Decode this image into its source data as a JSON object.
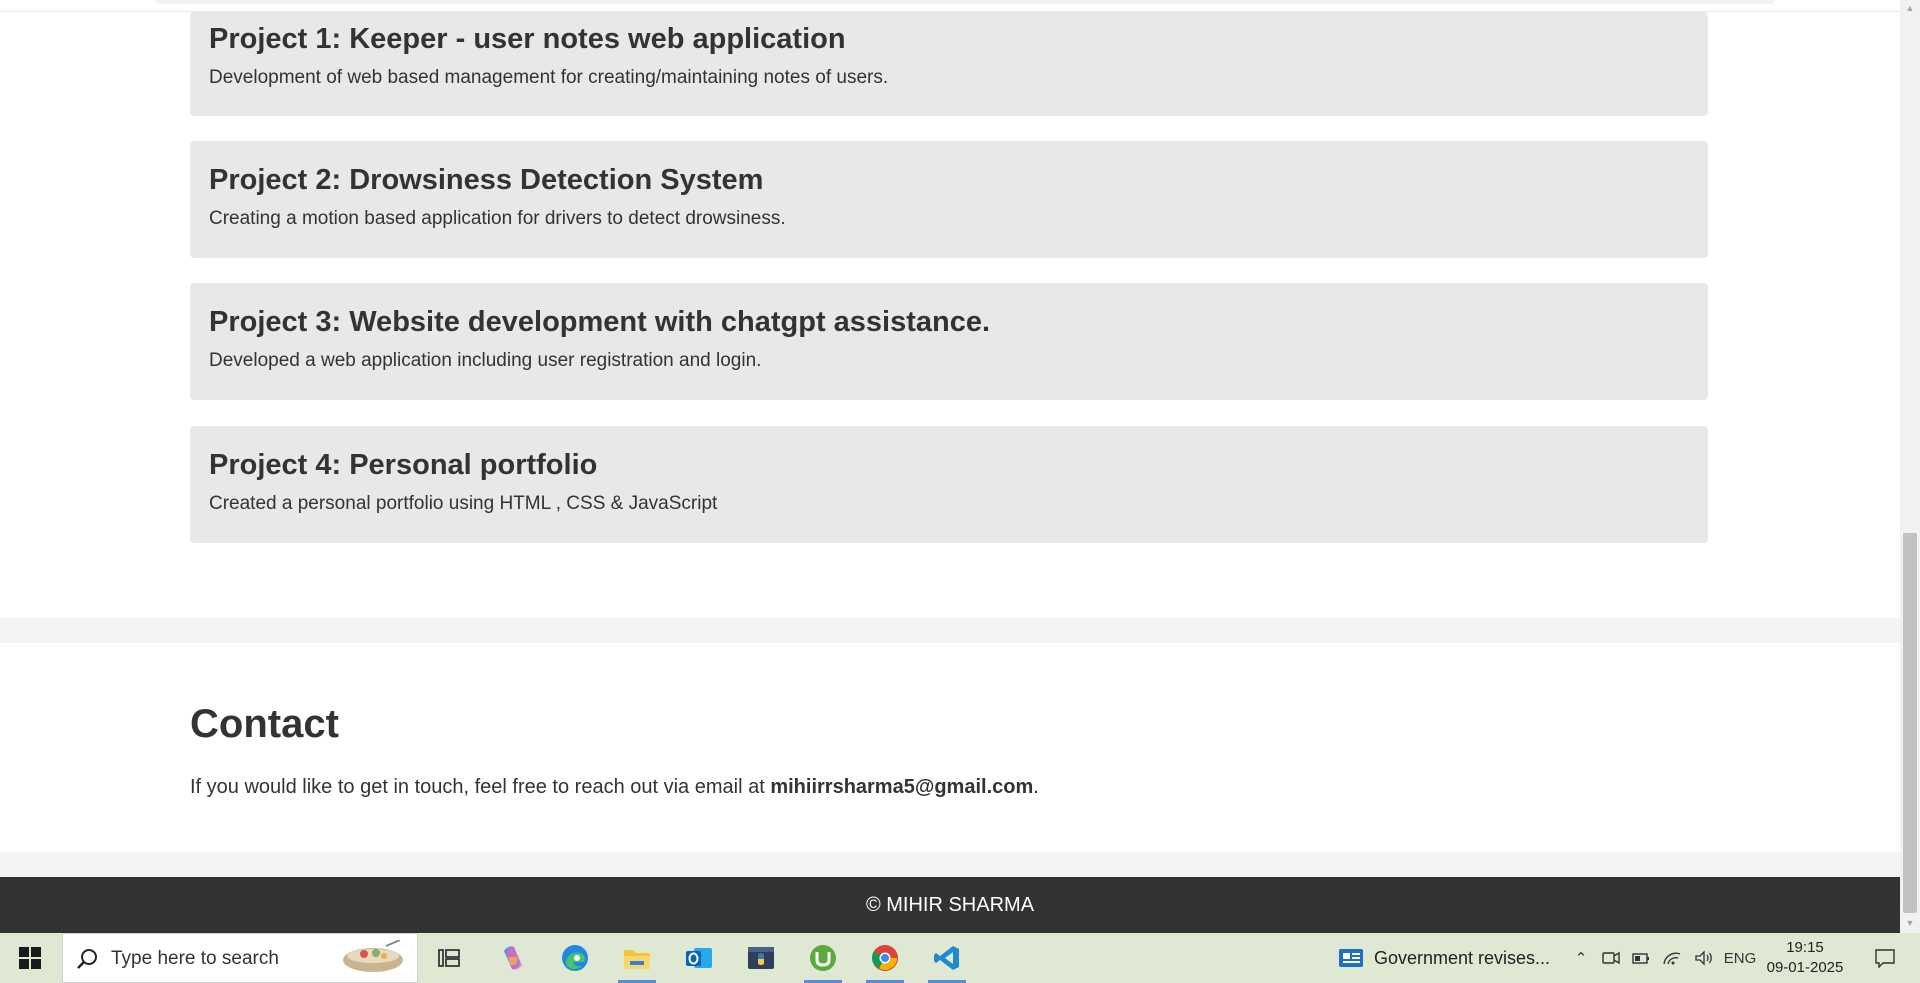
{
  "projects": [
    {
      "title": "Project 1: Keeper - user notes web application",
      "description": "Development of web based management for creating/maintaining notes of users."
    },
    {
      "title": "Project 2: Drowsiness Detection System",
      "description": "Creating a motion based application for drivers to detect drowsiness."
    },
    {
      "title": "Project 3: Website development with chatgpt assistance.",
      "description": "Developed a web application including user registration and login."
    },
    {
      "title": "Project 4: Personal portfolio",
      "description": "Created a personal portfolio using HTML , CSS & JavaScript"
    }
  ],
  "contact": {
    "title": "Contact",
    "text_before": "If you would like to get in touch, feel free to reach out via email at ",
    "email": "mihiirrsharma5@gmail.com",
    "text_after": "."
  },
  "footer": {
    "text": "© MIHIR SHARMA"
  },
  "taskbar": {
    "search_placeholder": "Type here to search",
    "apps": [
      "task-view-icon",
      "copilot-icon",
      "edge-icon",
      "file-explorer-icon",
      "outlook-icon",
      "python-icon",
      "utorrent-icon",
      "chrome-icon",
      "vscode-icon"
    ],
    "notification": "Government revises...",
    "language": "ENG",
    "time": "19:15",
    "date": "09-01-2025"
  },
  "colors": {
    "card_bg": "#e8e8e8",
    "footer_bg": "#333333",
    "text": "#333333",
    "taskbar_bg": "#dfe8d3"
  }
}
